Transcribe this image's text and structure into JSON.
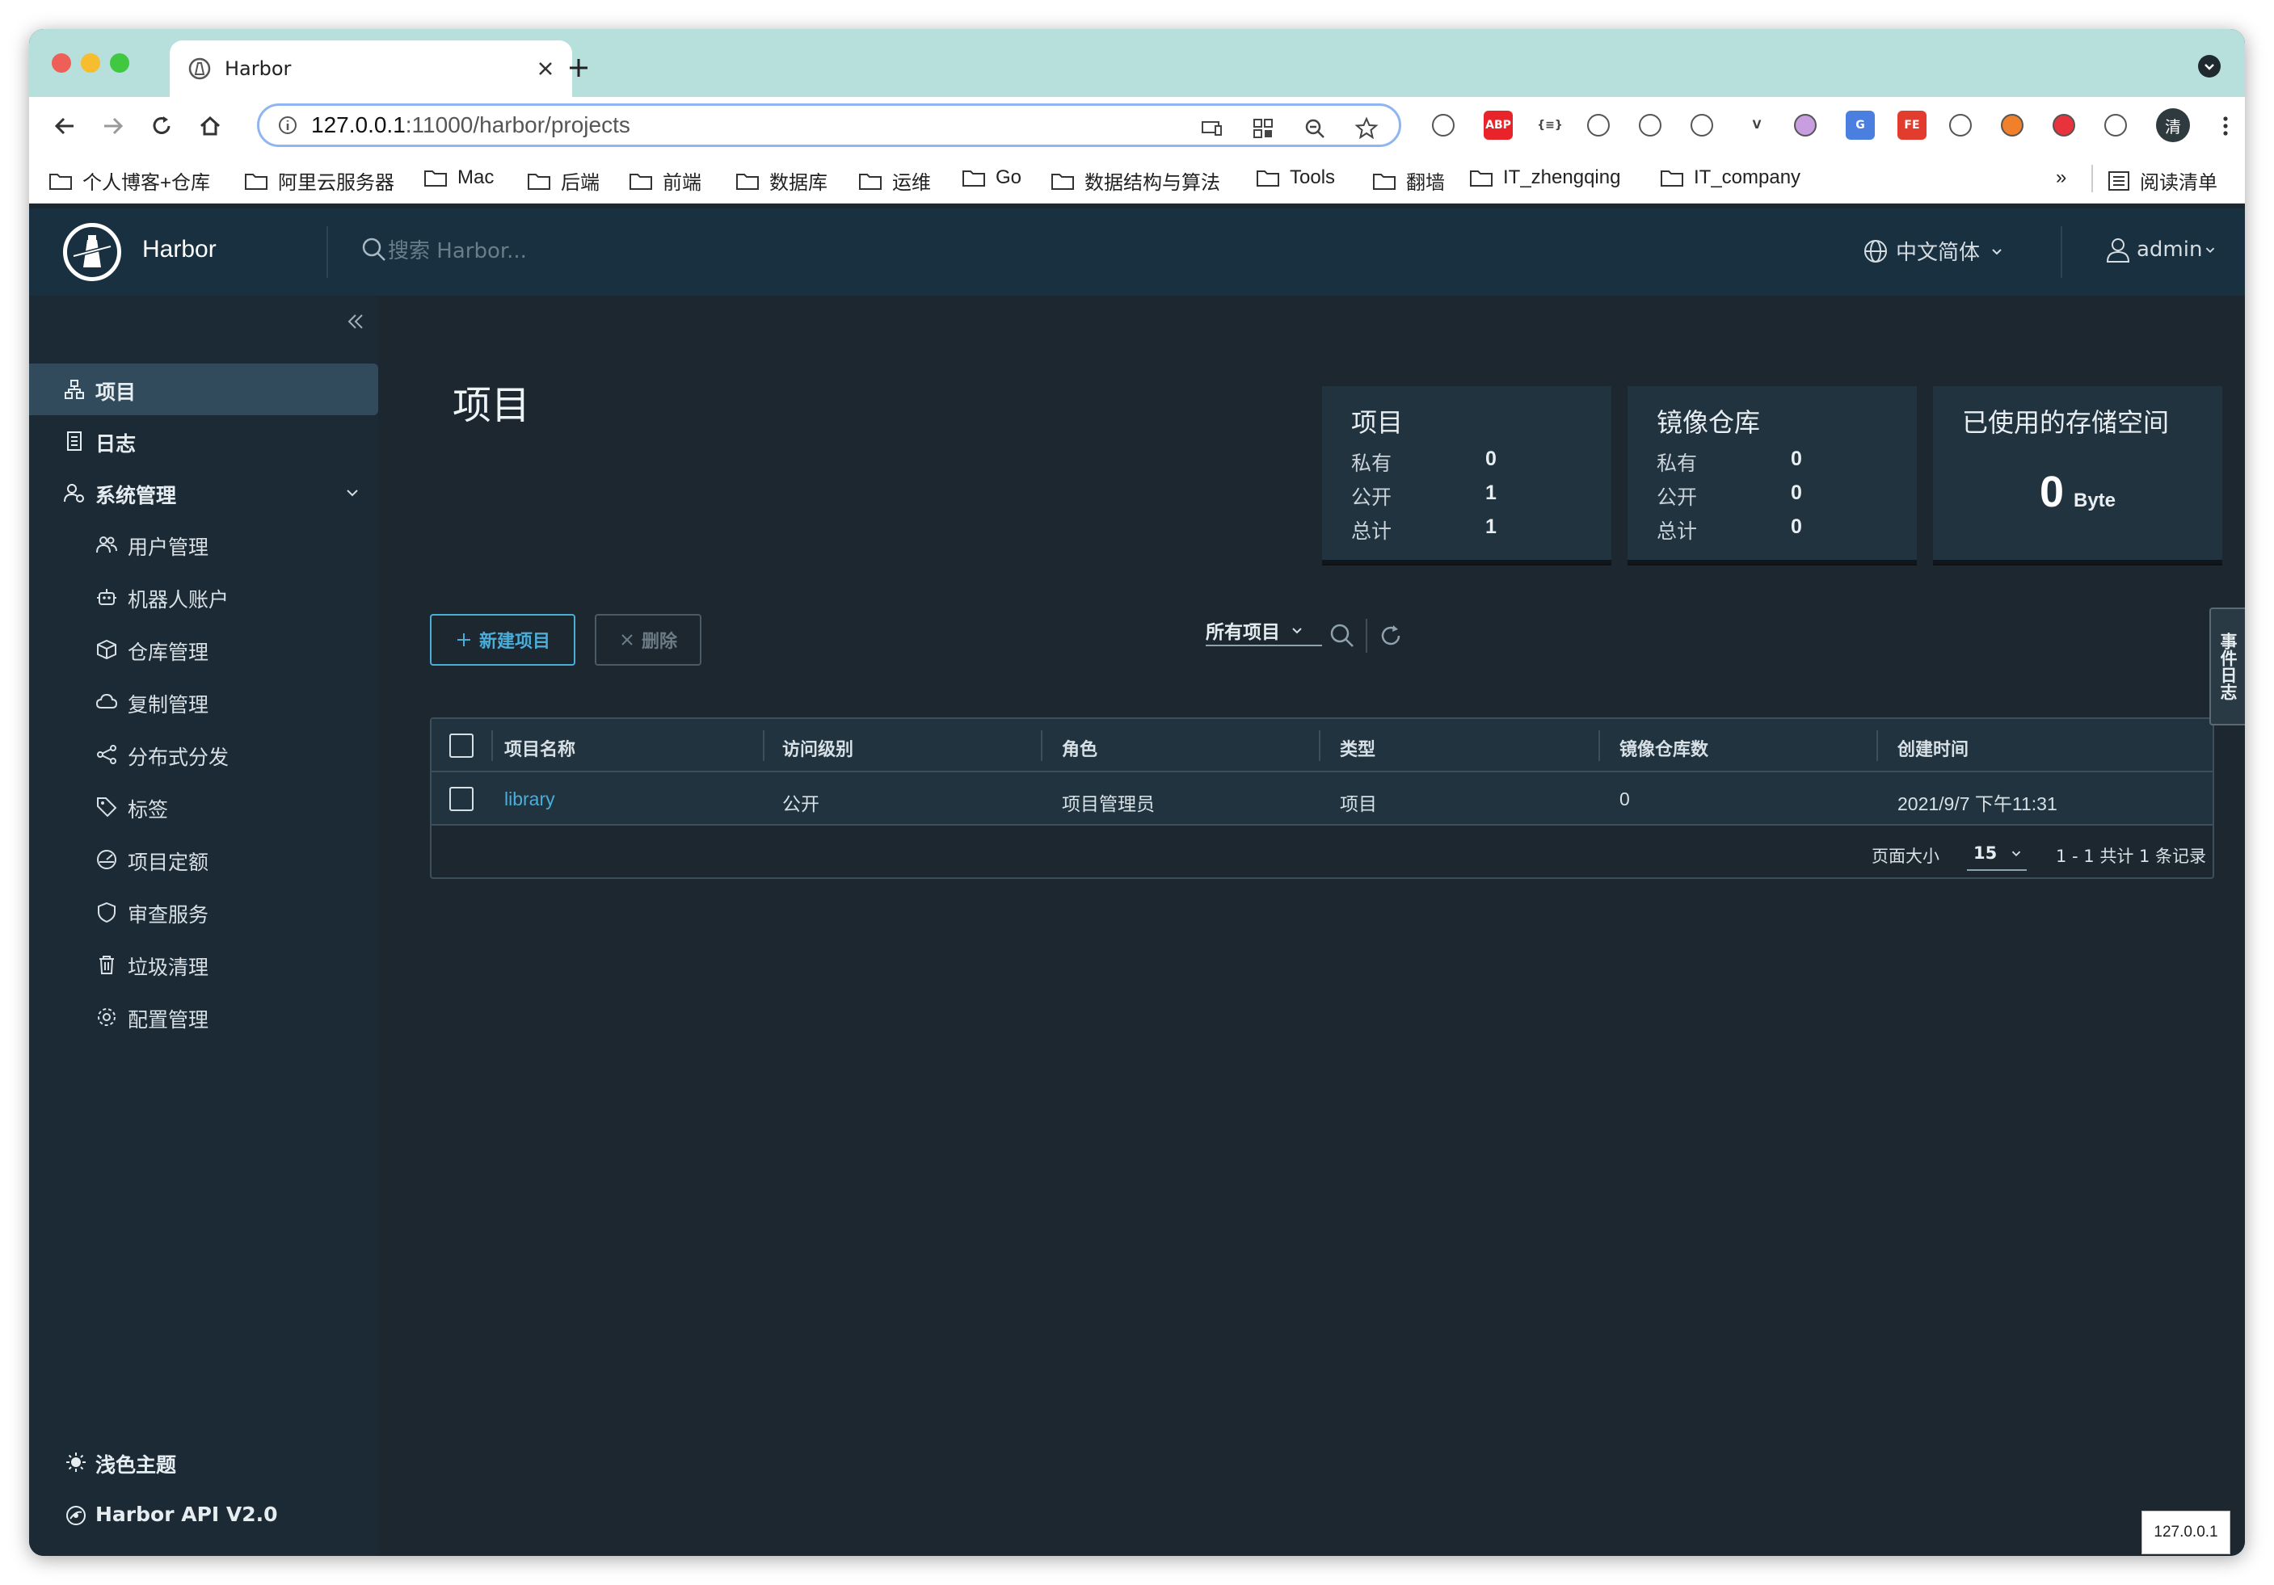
{
  "browser": {
    "tab_title": "Harbor",
    "url_host": "127.0.0.1",
    "url_rest": ":11000/harbor/projects",
    "bookmarks": [
      "个人博客+仓库",
      "阿里云服务器",
      "Mac",
      "后端",
      "前端",
      "数据库",
      "运维",
      "Go",
      "数据结构与算法",
      "Tools",
      "翻墙",
      "IT_zhengqing",
      "IT_company"
    ],
    "bookmarks_overflow": "»",
    "reading_list": "阅读清单",
    "profile_initial": "清",
    "extensions": [
      {
        "name": "feather-icon",
        "bg": "#ffffff",
        "text": ""
      },
      {
        "name": "adblock-icon",
        "bg": "#e8232a",
        "text": "ABP"
      },
      {
        "name": "json-icon",
        "bg": "#ffffff",
        "text": "{≡}"
      },
      {
        "name": "tree-icon",
        "bg": "#ffffff",
        "text": ""
      },
      {
        "name": "star-burst-icon",
        "bg": "#ffffff",
        "text": ""
      },
      {
        "name": "mask-icon",
        "bg": "#ffffff",
        "text": ""
      },
      {
        "name": "vue-devtools-icon",
        "bg": "#ffffff",
        "text": "V"
      },
      {
        "name": "purple-circle-icon",
        "bg": "#c89ee0",
        "text": ""
      },
      {
        "name": "translate-icon",
        "bg": "#4a7fe0",
        "text": "G"
      },
      {
        "name": "fe-icon",
        "bg": "#e23c2f",
        "text": "FE"
      },
      {
        "name": "screenshot-icon",
        "bg": "#ffffff",
        "text": ""
      },
      {
        "name": "orange-circle-icon",
        "bg": "#f0802a",
        "text": ""
      },
      {
        "name": "red-grid-icon",
        "bg": "#e8323c",
        "text": ""
      },
      {
        "name": "puzzle-icon",
        "bg": "#ffffff",
        "text": ""
      }
    ]
  },
  "header": {
    "brand": "Harbor",
    "search_placeholder": "搜索 Harbor...",
    "language": "中文简体",
    "user": "admin"
  },
  "sidebar": {
    "items": [
      {
        "label": "项目",
        "icon": "projects-icon",
        "active": true
      },
      {
        "label": "日志",
        "icon": "log-icon"
      },
      {
        "label": "系统管理",
        "icon": "admin-icon"
      }
    ],
    "sub_items": [
      {
        "label": "用户管理",
        "icon": "users-icon"
      },
      {
        "label": "机器人账户",
        "icon": "robot-icon"
      },
      {
        "label": "仓库管理",
        "icon": "registry-icon"
      },
      {
        "label": "复制管理",
        "icon": "replication-icon"
      },
      {
        "label": "分布式分发",
        "icon": "distribution-icon"
      },
      {
        "label": "标签",
        "icon": "tag-icon"
      },
      {
        "label": "项目定额",
        "icon": "quota-icon"
      },
      {
        "label": "审查服务",
        "icon": "shield-icon"
      },
      {
        "label": "垃圾清理",
        "icon": "trash-icon"
      },
      {
        "label": "配置管理",
        "icon": "gear-icon"
      }
    ],
    "theme": "浅色主题",
    "api": "Harbor API V2.0"
  },
  "main": {
    "title": "项目",
    "cards": {
      "projects": {
        "title": "项目",
        "rows": [
          {
            "label": "私有",
            "value": "0"
          },
          {
            "label": "公开",
            "value": "1"
          },
          {
            "label": "总计",
            "value": "1"
          }
        ]
      },
      "repos": {
        "title": "镜像仓库",
        "rows": [
          {
            "label": "私有",
            "value": "0"
          },
          {
            "label": "公开",
            "value": "0"
          },
          {
            "label": "总计",
            "value": "0"
          }
        ]
      },
      "storage": {
        "title": "已使用的存储空间",
        "value": "0",
        "unit": "Byte"
      }
    },
    "buttons": {
      "new_project": "新建项目",
      "delete": "删除"
    },
    "filter": "所有项目",
    "table": {
      "columns": [
        "项目名称",
        "访问级别",
        "角色",
        "类型",
        "镜像仓库数",
        "创建时间"
      ],
      "rows": [
        {
          "name": "library",
          "access": "公开",
          "role": "项目管理员",
          "type": "项目",
          "repo_count": "0",
          "created": "2021/9/7 下午11:31"
        }
      ],
      "page_size_label": "页面大小",
      "page_size": "15",
      "summary": "1 - 1 共计 1 条记录"
    },
    "event_tab": "事件日志",
    "host_tooltip": "127.0.0.1"
  },
  "colors": {
    "header_bg": "#18303f",
    "sidebar_bg": "#1b2a35",
    "main_bg": "#1c2730",
    "accent": "#4aaed9",
    "link": "#4aaed9"
  }
}
